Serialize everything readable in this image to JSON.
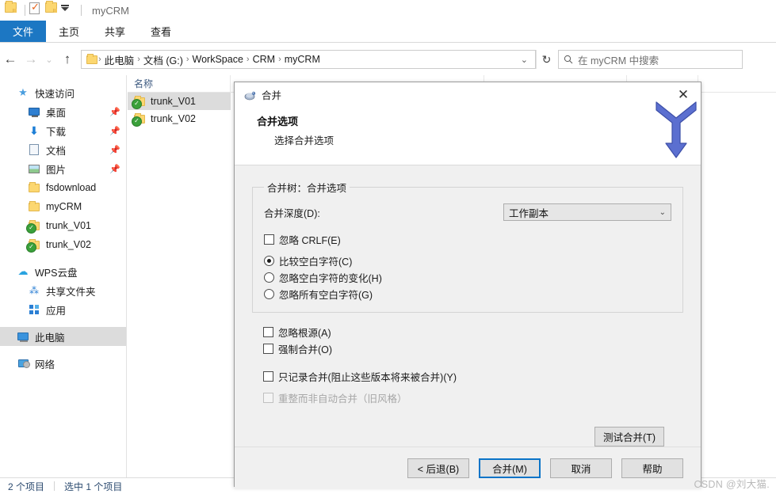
{
  "window": {
    "title": "myCRM",
    "quick_access": [
      "folder-icon",
      "properties-icon",
      "new-folder-icon",
      "customize-caret-icon"
    ]
  },
  "ribbon": {
    "tabs": [
      {
        "label": "文件",
        "active": true
      },
      {
        "label": "主页",
        "active": false
      },
      {
        "label": "共享",
        "active": false
      },
      {
        "label": "查看",
        "active": false
      }
    ]
  },
  "address_bar": {
    "back_icon": "←",
    "forward_icon": "→",
    "history_icon": "⌄",
    "up_icon": "↑",
    "crumbs": [
      "此电脑",
      "文档 (G:)",
      "WorkSpace",
      "CRM",
      "myCRM"
    ],
    "separator": "›",
    "dropdown_icon": "⌄",
    "refresh_icon": "↻"
  },
  "search": {
    "icon": "search-icon",
    "placeholder": "在 myCRM 中搜索"
  },
  "nav_pane": {
    "items": [
      {
        "label": "快速访问",
        "icon": "star-icon",
        "indent": 0,
        "pinned": false,
        "selected": false
      },
      {
        "label": "桌面",
        "icon": "desktop-icon",
        "indent": 1,
        "pinned": true,
        "selected": false
      },
      {
        "label": "下载",
        "icon": "download-icon",
        "indent": 1,
        "pinned": true,
        "selected": false
      },
      {
        "label": "文档",
        "icon": "document-icon",
        "indent": 1,
        "pinned": true,
        "selected": false
      },
      {
        "label": "图片",
        "icon": "picture-icon",
        "indent": 1,
        "pinned": true,
        "selected": false
      },
      {
        "label": "fsdownload",
        "icon": "folder-icon",
        "indent": 1,
        "pinned": false,
        "selected": false
      },
      {
        "label": "myCRM",
        "icon": "folder-icon",
        "indent": 1,
        "pinned": false,
        "selected": false
      },
      {
        "label": "trunk_V01",
        "icon": "folder-svn-icon",
        "indent": 1,
        "pinned": false,
        "selected": false
      },
      {
        "label": "trunk_V02",
        "icon": "folder-svn-icon",
        "indent": 1,
        "pinned": false,
        "selected": false
      },
      {
        "label": "WPS云盘",
        "icon": "cloud-icon",
        "indent": 0,
        "pinned": false,
        "selected": false
      },
      {
        "label": "共享文件夹",
        "icon": "share-icon",
        "indent": 1,
        "pinned": false,
        "selected": false
      },
      {
        "label": "应用",
        "icon": "apps-icon",
        "indent": 1,
        "pinned": false,
        "selected": false
      },
      {
        "label": "此电脑",
        "icon": "this-pc-icon",
        "indent": 0,
        "pinned": false,
        "selected": true
      },
      {
        "label": "网络",
        "icon": "network-icon",
        "indent": 0,
        "pinned": false,
        "selected": false
      }
    ]
  },
  "file_list": {
    "columns": [
      "名称"
    ],
    "rows": [
      {
        "name": "trunk_V01",
        "icon": "folder-svn-icon",
        "selected": true
      },
      {
        "name": "trunk_V02",
        "icon": "folder-svn-icon",
        "selected": false
      }
    ]
  },
  "status_bar": {
    "item_count": "2 个项目",
    "selection": "选中 1 个项目"
  },
  "dialog": {
    "title": "合并",
    "icon": "tortoisesvn-icon",
    "close_icon": "✕",
    "art_icon": "merge-arrow-icon",
    "heading": "合并选项",
    "subheading": "选择合并选项",
    "group": {
      "legend": "合并树：合并选项",
      "depth_label": "合并深度(D):",
      "depth_value": "工作副本",
      "depth_caret": "⌄",
      "checkbox_crlf": {
        "label": "忽略 CRLF(E)",
        "checked": false
      },
      "radios": [
        {
          "label": "比较空白字符(C)",
          "checked": true
        },
        {
          "label": "忽略空白字符的变化(H)",
          "checked": false
        },
        {
          "label": "忽略所有空白字符(G)",
          "checked": false
        }
      ]
    },
    "options": [
      {
        "label": "忽略根源(A)",
        "checked": false,
        "disabled": false
      },
      {
        "label": "强制合并(O)",
        "checked": false,
        "disabled": false
      }
    ],
    "options_lower": [
      {
        "label": "只记录合并(阻止这些版本将来被合并)(Y)",
        "checked": false,
        "disabled": false
      },
      {
        "label": "重整而非自动合并（旧风格）",
        "checked": false,
        "disabled": true
      }
    ],
    "test_button": "测试合并(T)",
    "buttons": {
      "back": "< 后退(B)",
      "merge": "合并(M)",
      "cancel": "取消",
      "help": "帮助"
    }
  },
  "watermark": "CSDN @刘大猫."
}
